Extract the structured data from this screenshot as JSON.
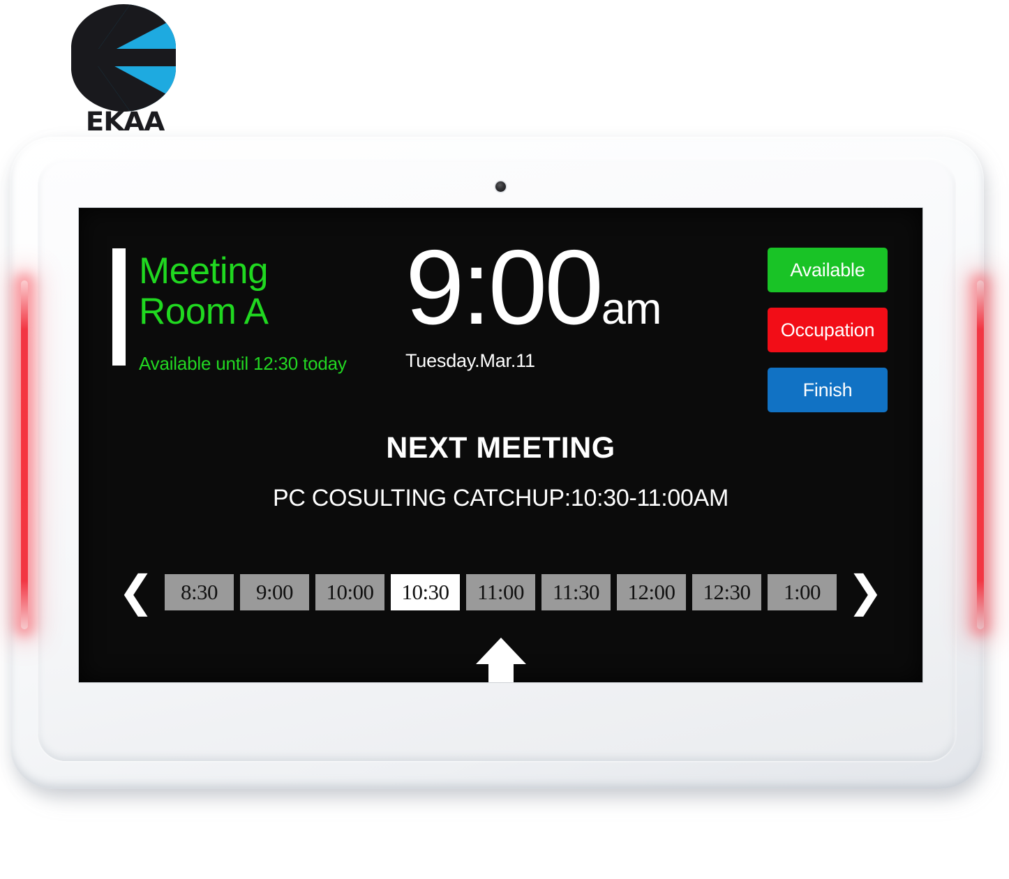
{
  "brand": {
    "wordmark": "EKAA",
    "logo_icon": "ekaa-hexagon-logo",
    "colors": {
      "blue": "#1eaae0",
      "dark": "#1b1b1f"
    }
  },
  "device": {
    "type": "wall-mounted-meeting-room-tablet",
    "camera_icon": "front-camera-lens",
    "led_color": "#f23643",
    "led_status": "occupied-red"
  },
  "screen": {
    "room": {
      "name_line1": "Meeting",
      "name_line2": "Room A",
      "availability": "Available until 12:30 today",
      "accent_color": "#20d820"
    },
    "clock": {
      "time": "9:00",
      "meridiem": "am",
      "date": "Tuesday.Mar.11"
    },
    "status_buttons": [
      {
        "label": "Available",
        "color": "#19c326",
        "name": "available-button"
      },
      {
        "label": "Occupation",
        "color": "#f20d17",
        "name": "occupation-button"
      },
      {
        "label": "Finish",
        "color": "#1172c4",
        "name": "finish-button"
      }
    ],
    "next_meeting": {
      "heading": "NEXT MEETING",
      "detail": "PC COSULTING CATCHUP:10:30-11:00AM"
    },
    "timeline": {
      "prev_icon": "chevron-left-icon",
      "next_icon": "chevron-right-icon",
      "prev_glyph": "❮",
      "next_glyph": "❯",
      "selected": "10:30",
      "slots": [
        {
          "label": "8:30",
          "selected": false
        },
        {
          "label": "9:00",
          "selected": false
        },
        {
          "label": "10:00",
          "selected": false
        },
        {
          "label": "10:30",
          "selected": true
        },
        {
          "label": "11:00",
          "selected": false
        },
        {
          "label": "11:30",
          "selected": false
        },
        {
          "label": "12:00",
          "selected": false
        },
        {
          "label": "12:30",
          "selected": false
        },
        {
          "label": "1:00",
          "selected": false
        }
      ]
    },
    "home_arrow_icon": "arrow-up-home-icon"
  }
}
